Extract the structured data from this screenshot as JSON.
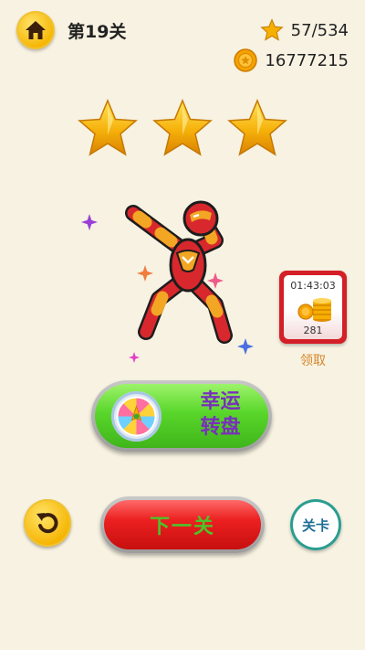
{
  "header": {
    "level_title": "第19关",
    "stars_progress": "57/534",
    "coins": "16777215"
  },
  "rating": {
    "stars_earned": 3,
    "stars_total": 3
  },
  "reward": {
    "timer": "01:43:03",
    "amount": "281",
    "label": "领取"
  },
  "lucky_wheel": {
    "line1": "幸运",
    "line2": "转盘"
  },
  "actions": {
    "next_label": "下一关",
    "levels_label": "关卡"
  },
  "colors": {
    "background": "#f7f2e2",
    "gold": "#f5b400",
    "green_button": "#4bc322",
    "red_button": "#e21b1b",
    "character_red": "#d8282d",
    "character_yellow": "#f2a623",
    "wheel_text": "#7a2fbc",
    "reward_label": "#d6872a"
  }
}
